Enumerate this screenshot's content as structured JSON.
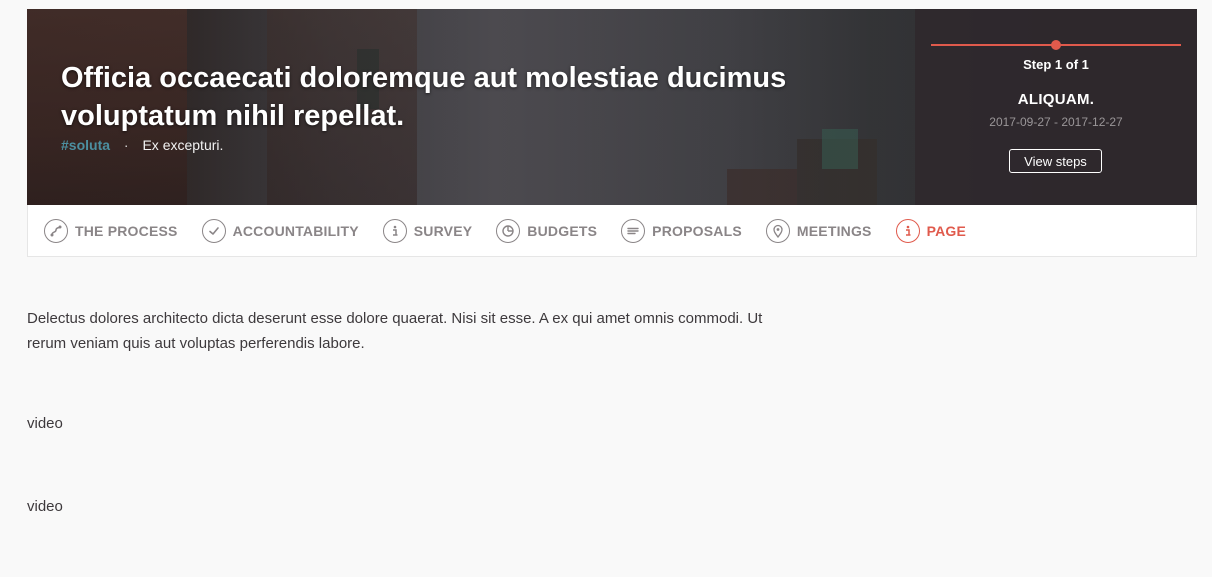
{
  "hero": {
    "title": "Officia occaecati doloremque aut molestiae ducimus voluptatum nihil repellat.",
    "hashtag": "#soluta",
    "separator": "·",
    "subtitle": "Ex excepturi."
  },
  "steps": {
    "label": "Step 1 of 1",
    "current_name": "ALIQUAM.",
    "dates": "2017-09-27 - 2017-12-27",
    "button_label": "View steps",
    "progress_fraction": 0.5
  },
  "nav": {
    "items": [
      {
        "label": "THE PROCESS",
        "icon": "process-icon",
        "active": false
      },
      {
        "label": "ACCOUNTABILITY",
        "icon": "check-icon",
        "active": false
      },
      {
        "label": "SURVEY",
        "icon": "info-icon",
        "active": false
      },
      {
        "label": "BUDGETS",
        "icon": "pie-chart-icon",
        "active": false
      },
      {
        "label": "PROPOSALS",
        "icon": "text-lines-icon",
        "active": false
      },
      {
        "label": "MEETINGS",
        "icon": "map-pin-icon",
        "active": false
      },
      {
        "label": "PAGE",
        "icon": "info-icon",
        "active": true
      }
    ]
  },
  "content": {
    "body": "Delectus dolores architecto dicta deserunt esse dolore quaerat. Nisi sit esse. A ex qui amet omnis commodi. Ut rerum veniam quis aut voluptas perferendis labore.",
    "video_1": "video",
    "video_2": "video"
  },
  "colors": {
    "accent": "#e05a4c",
    "hashtag": "#4c8fa0",
    "nav_text": "#8a8587"
  }
}
